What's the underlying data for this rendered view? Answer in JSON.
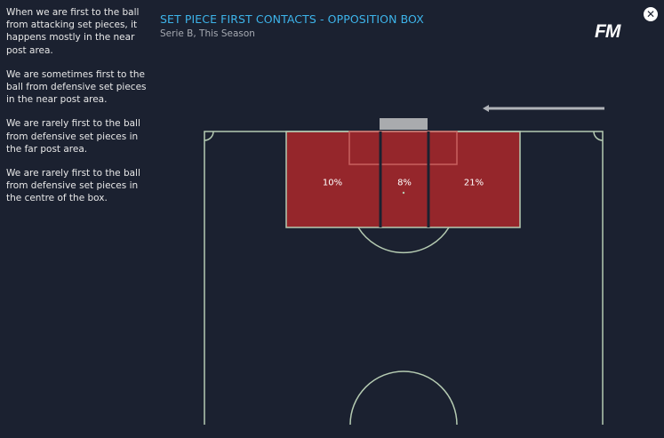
{
  "insights": [
    "When we are first to the ball from attacking set pieces, it happens mostly in the near post area.",
    "We are sometimes first to the ball from defensive set pieces in the near post area.",
    "We are rarely first to the ball from defensive set pieces in the far post area.",
    "We are rarely first to the ball from defensive set pieces in the centre of the box."
  ],
  "header": {
    "title": "SET PIECE FIRST CONTACTS - OPPOSITION BOX",
    "subtitle": "Serie B, This Season"
  },
  "logo": "FM",
  "close_icon": "close-icon",
  "zones": [
    {
      "name": "near-post",
      "label": "10%",
      "value": 10
    },
    {
      "name": "centre",
      "label": "8%",
      "value": 8
    },
    {
      "name": "far-post",
      "label": "21%",
      "value": 21
    }
  ],
  "colors": {
    "background": "#1b2130",
    "accent": "#3db4ea",
    "zone_fill": "#95262b",
    "pitch_line": "#b5cbb2"
  }
}
